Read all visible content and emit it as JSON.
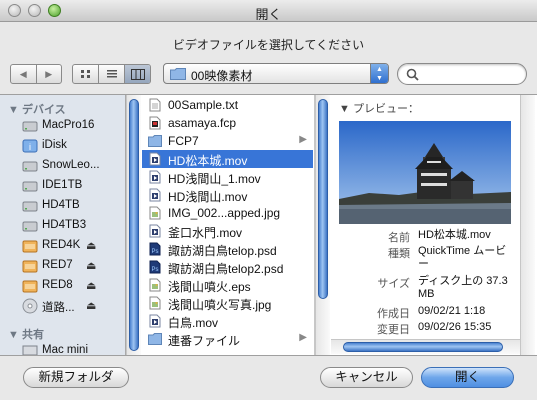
{
  "window": {
    "title": "開く"
  },
  "prompt": "ビデオファイルを選択してください",
  "toolbar": {
    "location": "00映像素材",
    "search_value": ""
  },
  "sidebar": {
    "devices_header": "デバイス",
    "devices": [
      {
        "label": "MacPro16",
        "icon": "hard-disk-icon",
        "eject": false
      },
      {
        "label": "iDisk",
        "icon": "idisk-icon",
        "eject": false
      },
      {
        "label": "SnowLeo...",
        "icon": "hard-disk-icon",
        "eject": false
      },
      {
        "label": "IDE1TB",
        "icon": "hard-disk-icon",
        "eject": false
      },
      {
        "label": "HD4TB",
        "icon": "hard-disk-icon",
        "eject": false
      },
      {
        "label": "HD4TB3",
        "icon": "hard-disk-icon",
        "eject": false
      },
      {
        "label": "RED4K",
        "icon": "external-disk-icon",
        "eject": true
      },
      {
        "label": "RED7",
        "icon": "external-disk-icon",
        "eject": true
      },
      {
        "label": "RED8",
        "icon": "external-disk-icon",
        "eject": true
      },
      {
        "label": "道路...",
        "icon": "optical-disc-icon",
        "eject": true
      }
    ],
    "shared_header": "共有",
    "shared": [
      {
        "label": "Mac mini",
        "icon": "computer-icon"
      }
    ],
    "eject_glyph": "⏏"
  },
  "files": [
    {
      "name": "00Sample.txt",
      "icon": "text-file-icon",
      "selected": false,
      "folder": false
    },
    {
      "name": "asamaya.fcp",
      "icon": "fcp-file-icon",
      "selected": false,
      "folder": false
    },
    {
      "name": "FCP7",
      "icon": "folder-icon",
      "selected": false,
      "folder": true
    },
    {
      "name": "HD松本城.mov",
      "icon": "movie-file-icon",
      "selected": true,
      "folder": false
    },
    {
      "name": "HD浅間山_1.mov",
      "icon": "movie-file-icon",
      "selected": false,
      "folder": false
    },
    {
      "name": "HD浅間山.mov",
      "icon": "movie-file-icon",
      "selected": false,
      "folder": false
    },
    {
      "name": "IMG_002...apped.jpg",
      "icon": "image-file-icon",
      "selected": false,
      "folder": false
    },
    {
      "name": "釜口水門.mov",
      "icon": "movie-file-icon",
      "selected": false,
      "folder": false
    },
    {
      "name": "諏訪湖白鳥telop.psd",
      "icon": "psd-file-icon",
      "selected": false,
      "folder": false
    },
    {
      "name": "諏訪湖白鳥telop2.psd",
      "icon": "psd-file-icon",
      "selected": false,
      "folder": false
    },
    {
      "name": "浅間山噴火.eps",
      "icon": "image-file-icon",
      "selected": false,
      "folder": false
    },
    {
      "name": "浅間山噴火写真.jpg",
      "icon": "image-file-icon",
      "selected": false,
      "folder": false
    },
    {
      "name": "白鳥.mov",
      "icon": "movie-file-icon",
      "selected": false,
      "folder": false
    },
    {
      "name": "連番ファイル",
      "icon": "folder-icon",
      "selected": false,
      "folder": true
    }
  ],
  "preview": {
    "header": "プレビュー：",
    "meta": [
      {
        "key": "名前",
        "value": "HD松本城.mov"
      },
      {
        "key": "種類",
        "value": "QuickTime ムービー"
      },
      {
        "key": "サイズ",
        "value": "ディスク上の 37.3 MB"
      },
      {
        "key": "作成日",
        "value": "09/02/21 1:18"
      },
      {
        "key": "変更日",
        "value": "09/02/26 15:35"
      }
    ]
  },
  "buttons": {
    "new_folder": "新規フォルダ",
    "cancel": "キャンセル",
    "open": "開く"
  },
  "colors": {
    "selection": "#3875d7",
    "sidebar_bg": "#dfe5ed",
    "default_button": "#4f8fe2"
  }
}
